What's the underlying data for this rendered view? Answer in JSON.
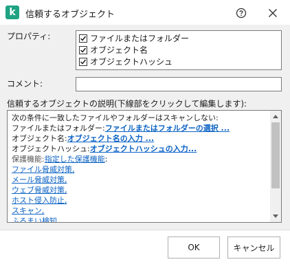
{
  "window": {
    "title": "信頼するオブジェクト",
    "logo_letter": "k"
  },
  "form": {
    "properties_label": "プロパティ:",
    "properties": [
      {
        "label": "ファイルまたはフォルダー",
        "checked": true
      },
      {
        "label": "オブジェクト名",
        "checked": true
      },
      {
        "label": "オブジェクトハッシュ",
        "checked": true
      }
    ],
    "comment_label": "コメント:",
    "comment_value": "",
    "description_label": "信頼するオブジェクトの説明(下線部をクリックして編集します):"
  },
  "description": {
    "line1": "次の条件に一致したファイルやフォルダーはスキャンしない:",
    "file_prefix": "ファイルまたはフォルダー:",
    "file_link": "ファイルまたはフォルダーの選択 ...",
    "name_prefix": "オブジェクト名:",
    "name_link": "オブジェクト名の入力 ...",
    "hash_prefix": "オブジェクトハッシュ:",
    "hash_link": "オブジェクトハッシュの入力...",
    "protect_prefix": "保護機能:",
    "protect_link": "指定した保護機能",
    "protect_suffix": ":",
    "components": [
      "ファイル脅威対策,",
      "メール脅威対策,",
      "ウェブ脅威対策,",
      "ホスト侵入防止,",
      "スキャン,",
      "ふるまい検知"
    ]
  },
  "buttons": {
    "ok": "OK",
    "cancel": "キャンセル"
  },
  "colors": {
    "accent": "#1fa383",
    "link": "#0b62c4"
  }
}
